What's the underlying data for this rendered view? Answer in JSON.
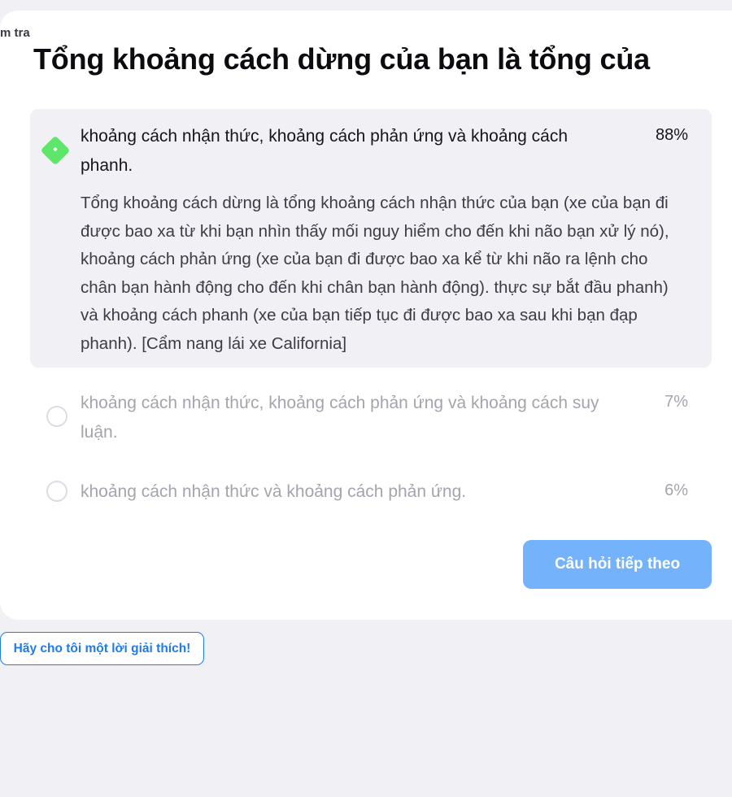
{
  "header": {
    "corner_tag": "m tra"
  },
  "question": {
    "title": "Tổng khoảng cách dừng của bạn là tổng của"
  },
  "answers": [
    {
      "text": "khoảng cách nhận thức, khoảng cách phản ứng và khoảng cách phanh.",
      "percent": "88%",
      "state": "selected-correct",
      "explanation": "Tổng khoảng cách dừng là tổng khoảng cách nhận thức của bạn (xe của bạn đi được bao xa từ khi bạn nhìn thấy mối nguy hiểm cho đến khi não bạn xử lý nó), khoảng cách phản ứng (xe của bạn đi được bao xa kể từ khi não ra lệnh cho chân bạn hành động cho đến khi chân bạn hành động). thực sự bắt đầu phanh) và khoảng cách phanh (xe của bạn tiếp tục đi được bao xa sau khi bạn đạp phanh). [Cẩm nang lái xe California]"
    },
    {
      "text": "khoảng cách nhận thức, khoảng cách phản ứng và khoảng cách suy luận.",
      "percent": "7%",
      "state": "unselected"
    },
    {
      "text": "khoảng cách nhận thức và khoảng cách phản ứng.",
      "percent": "6%",
      "state": "unselected"
    }
  ],
  "actions": {
    "next_label": "Câu hỏi tiếp theo",
    "explain_label": "Hãy cho tôi một lời giải thích!"
  },
  "colors": {
    "correct_marker": "#5ee66b",
    "primary_button": "#74b2fb",
    "link_blue": "#1f7be6",
    "page_background": "#f0f0f5"
  }
}
